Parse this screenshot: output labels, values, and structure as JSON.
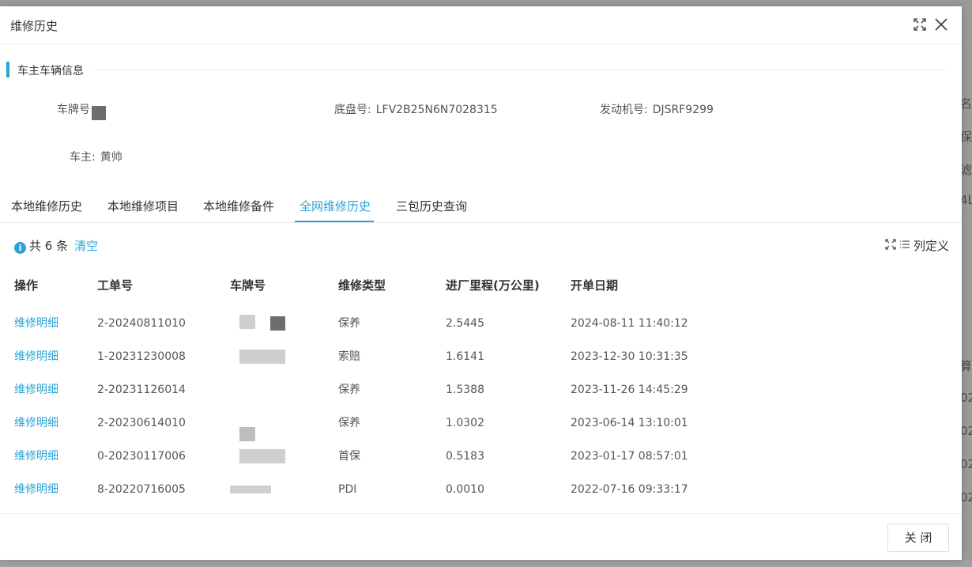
{
  "modal": {
    "title": "维修历史",
    "close_button": "关 闭"
  },
  "owner_section": {
    "title": "车主车辆信息",
    "plate_label": "车牌号",
    "chassis_label": "底盘号:",
    "chassis_value": "LFV2B25N6N7028315",
    "engine_label": "发动机号:",
    "engine_value": "DJSRF9299",
    "owner_label": "车主:",
    "owner_value": "黄帅"
  },
  "tabs": [
    {
      "label": "本地维修历史",
      "active": false
    },
    {
      "label": "本地维修项目",
      "active": false
    },
    {
      "label": "本地维修备件",
      "active": false
    },
    {
      "label": "全网维修历史",
      "active": true
    },
    {
      "label": "三包历史查询",
      "active": false
    }
  ],
  "summary": {
    "total": "共 6 条",
    "clear": "清空",
    "column_def": "列定义"
  },
  "table": {
    "columns": [
      "操作",
      "工单号",
      "车牌号",
      "维修类型",
      "进厂里程(万公里)",
      "开单日期"
    ],
    "rows": [
      {
        "action": "维修明细",
        "order": "2-20240811010",
        "type": "保养",
        "mileage": "2.5445",
        "date": "2024-08-11 11:40:12"
      },
      {
        "action": "维修明细",
        "order": "1-20231230008",
        "type": "索赔",
        "mileage": "1.6141",
        "date": "2023-12-30 10:31:35"
      },
      {
        "action": "维修明细",
        "order": "2-20231126014",
        "type": "保养",
        "mileage": "1.5388",
        "date": "2023-11-26 14:45:29"
      },
      {
        "action": "维修明细",
        "order": "2-20230614010",
        "type": "保养",
        "mileage": "1.0302",
        "date": "2023-06-14 13:10:01"
      },
      {
        "action": "维修明细",
        "order": "0-20230117006",
        "type": "首保",
        "mileage": "0.5183",
        "date": "2023-01-17 08:57:01"
      },
      {
        "action": "维修明细",
        "order": "8-20220716005",
        "type": "PDI",
        "mileage": "0.0010",
        "date": "2022-07-16 09:33:17"
      }
    ]
  },
  "background_fragments": [
    "名",
    "保",
    "滤",
    "4L",
    "算",
    "02",
    "02",
    "02",
    "02"
  ]
}
